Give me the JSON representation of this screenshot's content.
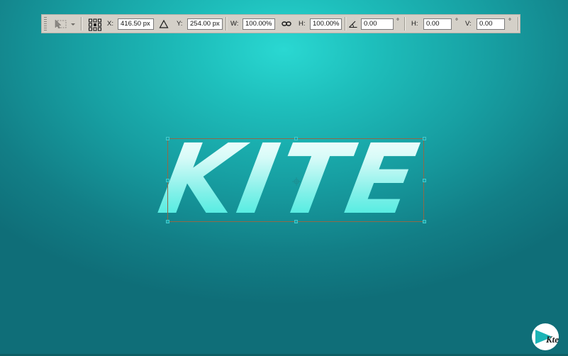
{
  "options_bar": {
    "x_label": "X:",
    "x_value": "416.50 px",
    "y_label": "Y:",
    "y_value": "254.00 px",
    "w_label": "W:",
    "w_value": "100.00%",
    "h_label": "H:",
    "h_value": "100.00%",
    "angle_value": "0.00",
    "angle_unit": "°",
    "skew_h_label": "H:",
    "skew_h_value": "0.00",
    "skew_h_unit": "°",
    "skew_v_label": "V:",
    "skew_v_value": "0.00",
    "skew_v_unit": "°",
    "icons": {
      "tool_preset": "move-transform-tool-icon",
      "dropdown": "chevron-down-icon",
      "reference_point": "reference-point-grid-icon",
      "relative_position": "delta-triangle-icon",
      "link": "link-chain-icon",
      "rotate": "rotate-angle-icon"
    }
  },
  "canvas": {
    "text_layer": "KITE",
    "colors": {
      "background_light": "#2ad8d2",
      "background_dark": "#0f6e78",
      "text_top": "#ffffff",
      "text_bottom": "#28e8da"
    }
  },
  "watermark": {
    "logo_text": "Kte",
    "icon": "kite-logo-icon"
  }
}
